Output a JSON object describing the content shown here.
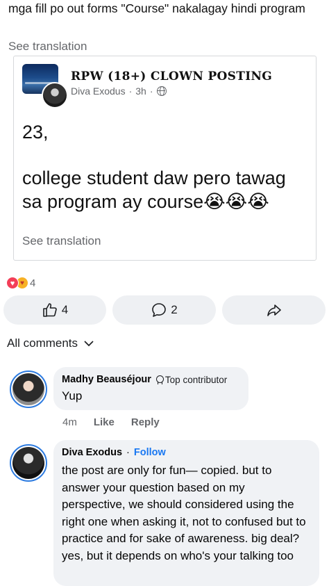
{
  "post": {
    "text": "mga fill po out forms \"Course\" nakalagay hindi program",
    "see_translation": "See translation"
  },
  "shared": {
    "group_name": "RPW (18+) CLOWN POSTING",
    "author": "Diva Exodus",
    "time": "3h",
    "line1": "23,",
    "line2": "college student daw pero tawag sa program ay course",
    "emojis": "😭😭😭",
    "see_translation": "See translation"
  },
  "reactions": {
    "icons": [
      "heart-reaction",
      "care-reaction"
    ],
    "count": "4"
  },
  "actions": {
    "like_count": "4",
    "comment_count": "2"
  },
  "comments_header": "All comments",
  "comments": [
    {
      "name": "Madhy Beauséjour",
      "badge": "Top contributor",
      "text": "Yup",
      "time": "4m",
      "like_label": "Like",
      "reply_label": "Reply"
    },
    {
      "name": "Diva Exodus",
      "follow": "Follow",
      "text": "the post are only for fun— copied. but to answer your question based on my perspective, we should considered using the right one when asking it, not to confused but to practice and for sake of awareness. big deal? yes, but it depends on who's your talking too"
    }
  ],
  "colors": {
    "accent": "#1877f2",
    "muted": "#65676b",
    "bubble": "#f0f2f5",
    "avatar_ring": "#2d7be0"
  }
}
